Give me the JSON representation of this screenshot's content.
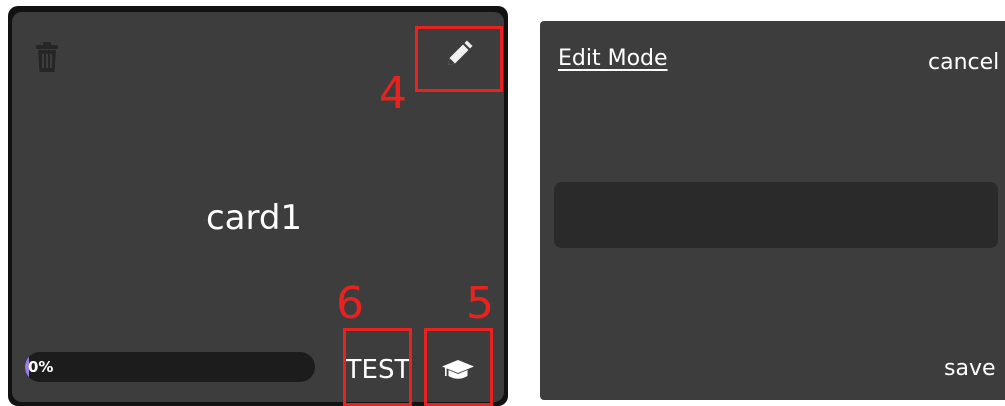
{
  "card": {
    "title": "card1",
    "progress_label": "0%",
    "progress_fraction": 0.0,
    "test_label": "TEST",
    "icons": {
      "delete": "trash-icon",
      "edit": "pencil-icon",
      "study": "graduation-cap-icon"
    }
  },
  "annotations": [
    {
      "label": "4",
      "target": "edit-button"
    },
    {
      "label": "5",
      "target": "study-button"
    },
    {
      "label": "6",
      "target": "test-button"
    }
  ],
  "edit_panel": {
    "title": "Edit Mode",
    "cancel_label": "cancel",
    "save_label": "save",
    "input_value": ""
  },
  "colors": {
    "card_background": "#3d3d3d",
    "field_background": "#2a2a2a",
    "progress_accent": "#9b7ee0",
    "annotation": "#e8231f"
  }
}
